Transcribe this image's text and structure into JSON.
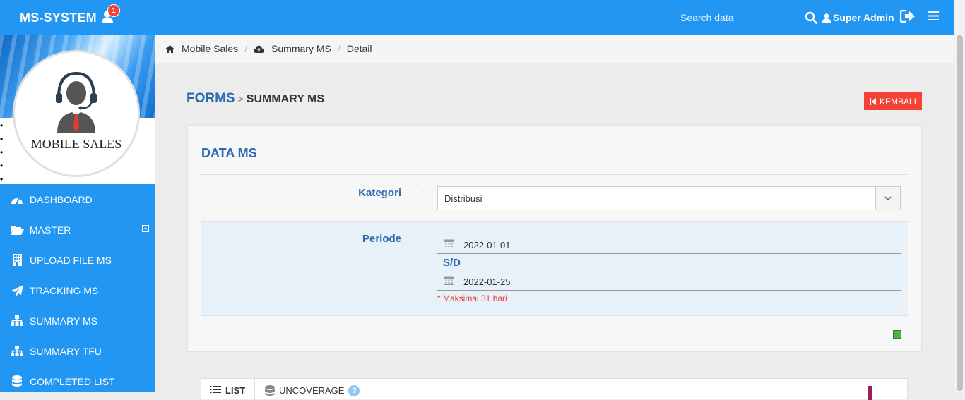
{
  "app": {
    "brand": "MS-SYSTEM",
    "notification_count": "1"
  },
  "search": {
    "placeholder": "Search data"
  },
  "user": {
    "name": "Super Admin"
  },
  "sidebar": {
    "profile_caption": "MOBILE SALES",
    "items": [
      {
        "label": "DASHBOARD",
        "icon": "dashboard-icon"
      },
      {
        "label": "MASTER",
        "icon": "folder-open-icon",
        "expandable": true
      },
      {
        "label": "UPLOAD FILE MS",
        "icon": "building-icon"
      },
      {
        "label": "TRACKING MS",
        "icon": "paper-plane-icon"
      },
      {
        "label": "SUMMARY MS",
        "icon": "sitemap-icon"
      },
      {
        "label": "SUMMARY TFU",
        "icon": "sitemap-icon"
      },
      {
        "label": "COMPLETED LIST",
        "icon": "database-icon"
      }
    ]
  },
  "breadcrumb": {
    "home": "Mobile Sales",
    "section": "Summary MS",
    "page": "Detail"
  },
  "page": {
    "forms": "FORMS",
    "separator": ">",
    "current": "SUMMARY MS",
    "back_label": "KEMBALI"
  },
  "form": {
    "title": "DATA MS",
    "kategori_label": "Kategori",
    "kategori_value": "Distribusi",
    "colon": ":",
    "periode_label": "Periode",
    "start_date": "2022-01-01",
    "sd_label": "S/D",
    "end_date": "2022-01-25",
    "hint": "* Maksimal 31 hari"
  },
  "list": {
    "tab_list": "LIST",
    "tab_uncoverage": "UNCOVERAGE",
    "info": "?"
  },
  "colors": {
    "primary": "#2196f3",
    "accent_text": "#2a6ab3",
    "danger": "#f44336",
    "success": "#4caf50"
  }
}
